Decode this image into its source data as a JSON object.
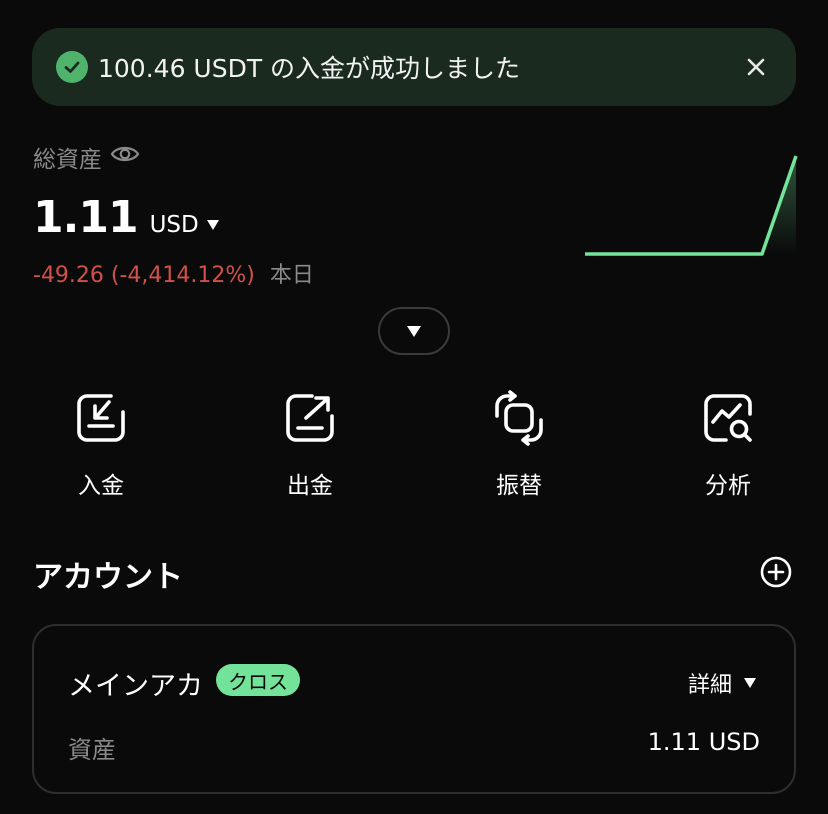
{
  "toast": {
    "message": "100.46 USDT の入金が成功しました"
  },
  "summary": {
    "label": "総資産",
    "balance": "1.11",
    "currency": "USD",
    "change": "-49.26 (-4,414.12%)",
    "period": "本日"
  },
  "actions": [
    {
      "label": "入金",
      "icon": "deposit-icon"
    },
    {
      "label": "出金",
      "icon": "withdraw-icon"
    },
    {
      "label": "振替",
      "icon": "transfer-icon"
    },
    {
      "label": "分析",
      "icon": "analytics-icon"
    }
  ],
  "accounts": {
    "title": "アカウント",
    "items": [
      {
        "name": "メインアカ",
        "badge": "クロス",
        "details_label": "詳細",
        "asset_label": "資産",
        "asset_value": "1.11 USD"
      }
    ]
  },
  "colors": {
    "positive": "#74e39a",
    "negative": "#d0504a",
    "background": "#0a0a0a"
  }
}
